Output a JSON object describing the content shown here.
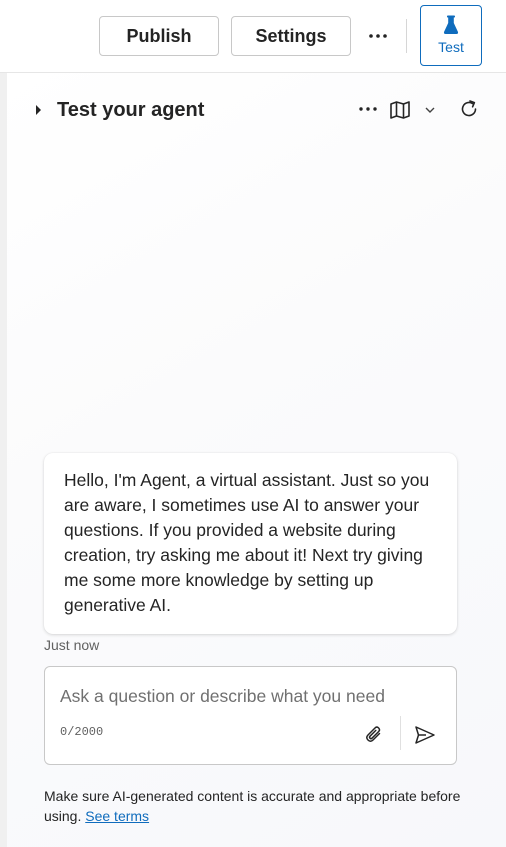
{
  "toolbar": {
    "publish_label": "Publish",
    "settings_label": "Settings",
    "more_icon": "more-horizontal-icon",
    "test_label": "Test",
    "test_icon": "beaker-icon"
  },
  "panel": {
    "title": "Test your agent",
    "caret_icon": "caret-right-icon",
    "more_icon": "more-horizontal-icon",
    "map_icon": "map-icon",
    "dropdown_icon": "chevron-down-icon",
    "refresh_icon": "refresh-icon"
  },
  "chat": {
    "message": "Hello, I'm Agent, a virtual assistant. Just so you are aware, I sometimes use AI to answer your questions. If you provided a website during creation, try asking me about it! Next try giving me some more knowledge by setting up generative AI.",
    "timestamp": "Just now"
  },
  "composer": {
    "placeholder": "Ask a question or describe what you need",
    "char_count": "0/2000",
    "attach_icon": "attach-icon",
    "send_icon": "send-icon"
  },
  "footer": {
    "disclaimer": "Make sure AI-generated content is accurate and appropriate before using.",
    "terms_link": "See terms"
  },
  "colors": {
    "accent": "#0f6cbd",
    "text": "#242424",
    "muted": "#616161"
  }
}
